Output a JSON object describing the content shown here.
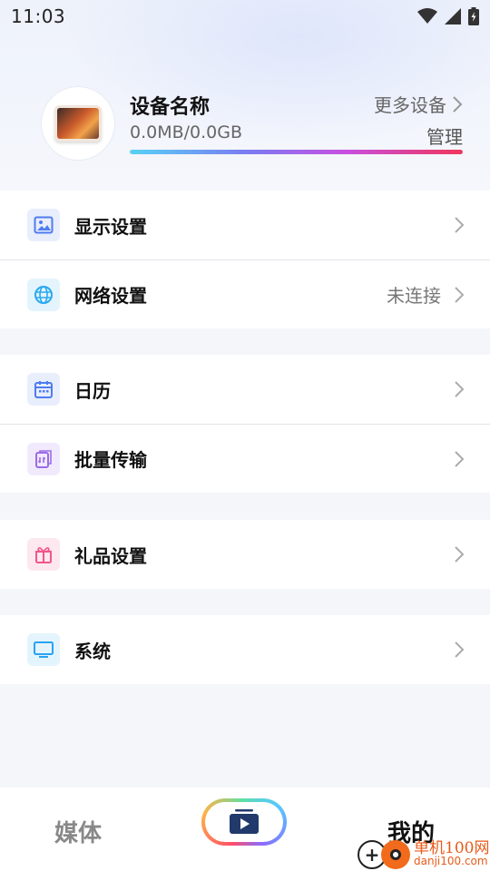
{
  "status_bar": {
    "time": "11:03"
  },
  "device": {
    "name": "设备名称",
    "storage": "0.0MB/0.0GB",
    "storage_used_fraction": 1.0,
    "more_devices": "更多设备",
    "manage": "管理"
  },
  "groups": [
    {
      "rows": [
        {
          "label": "显示设置",
          "value": "",
          "icon": "image-icon"
        },
        {
          "label": "网络设置",
          "value": "未连接",
          "icon": "globe-icon"
        }
      ]
    },
    {
      "rows": [
        {
          "label": "日历",
          "value": "",
          "icon": "calendar-icon"
        },
        {
          "label": "批量传输",
          "value": "",
          "icon": "transfer-icon"
        }
      ]
    },
    {
      "rows": [
        {
          "label": "礼品设置",
          "value": "",
          "icon": "gift-icon"
        }
      ]
    },
    {
      "rows": [
        {
          "label": "系统",
          "value": "",
          "icon": "monitor-icon"
        }
      ]
    }
  ],
  "bottom_nav": {
    "media": "媒体",
    "mine": "我的"
  },
  "watermark": {
    "line1": "单机100网",
    "line2": "danji100.com"
  },
  "colors": {
    "accent_blue": "#4f7cf2",
    "network_icon": "#29a9f0",
    "transfer_icon": "#9b6ce8",
    "gift_icon": "#f2558c",
    "system_icon": "#2aa3f2"
  }
}
